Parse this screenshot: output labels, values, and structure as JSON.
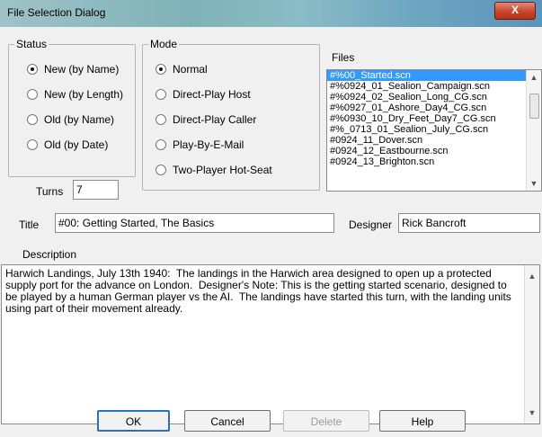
{
  "window": {
    "title": "File Selection Dialog",
    "close_glyph": "X"
  },
  "status": {
    "legend": "Status",
    "options": [
      {
        "label": "New (by Name)",
        "selected": true
      },
      {
        "label": "New (by Length)",
        "selected": false
      },
      {
        "label": "Old (by Name)",
        "selected": false
      },
      {
        "label": "Old (by Date)",
        "selected": false
      }
    ]
  },
  "mode": {
    "legend": "Mode",
    "options": [
      {
        "label": "Normal",
        "selected": true
      },
      {
        "label": "Direct-Play Host",
        "selected": false
      },
      {
        "label": "Direct-Play Caller",
        "selected": false
      },
      {
        "label": "Play-By-E-Mail",
        "selected": false
      },
      {
        "label": "Two-Player Hot-Seat",
        "selected": false
      }
    ]
  },
  "turns": {
    "label": "Turns",
    "value": "7"
  },
  "files": {
    "label": "Files",
    "items": [
      "#%00_Started.scn",
      "#%0924_01_Sealion_Campaign.scn",
      "#%0924_02_Sealion_Long_CG.scn",
      "#%0927_01_Ashore_Day4_CG.scn",
      "#%0930_10_Dry_Feet_Day7_CG.scn",
      "#%_0713_01_Sealion_July_CG.scn",
      "#0924_11_Dover.scn",
      "#0924_12_Eastbourne.scn",
      "#0924_13_Brighton.scn"
    ],
    "selected_index": 0
  },
  "title_field": {
    "label": "Title",
    "value": "#00: Getting Started, The Basics"
  },
  "designer_field": {
    "label": "Designer",
    "value": "Rick Bancroft"
  },
  "description": {
    "label": "Description",
    "text": "Harwich Landings, July 13th 1940:  The landings in the Harwich area designed to open up a protected supply port for the advance on London.  Designer's Note: This is the getting started scenario, designed to be played by a human German player vs the AI.  The landings have started this turn, with the landing units using part of their movement already."
  },
  "buttons": {
    "ok": "OK",
    "cancel": "Cancel",
    "delete": "Delete",
    "help": "Help"
  },
  "icons": {
    "scroll_up": "▲",
    "scroll_down": "▼"
  }
}
